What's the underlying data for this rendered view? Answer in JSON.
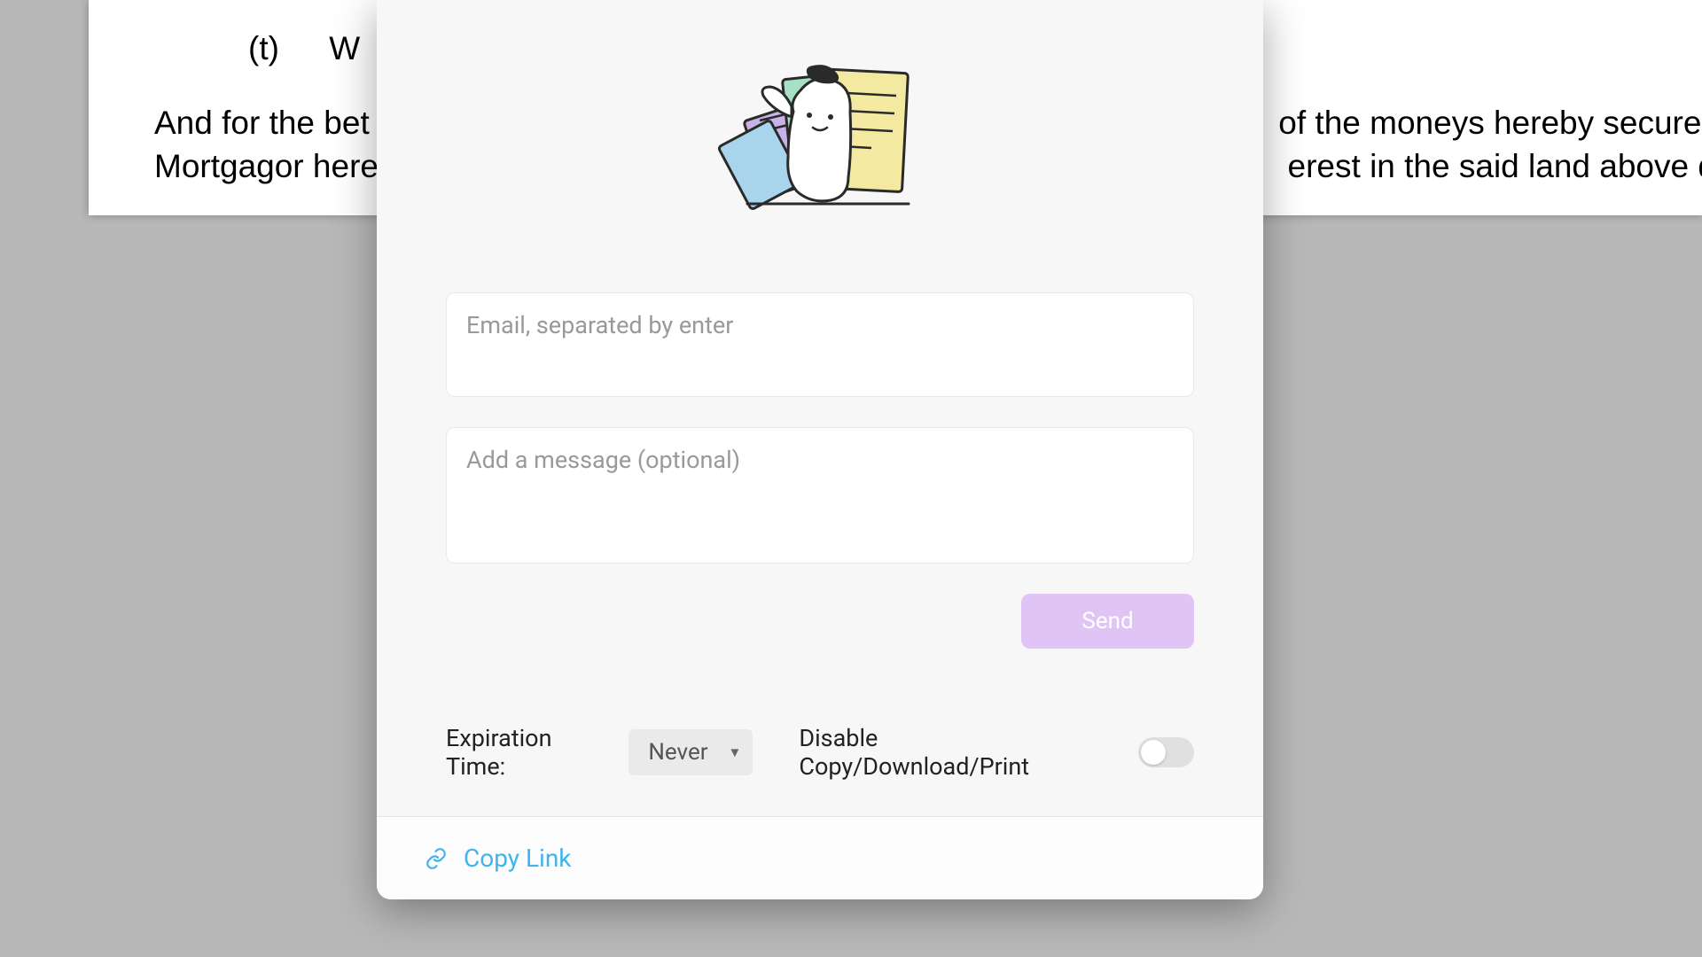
{
  "document": {
    "clause_letter": "(t)",
    "clause_start": "W",
    "paragraph_line1": "And for the bet",
    "paragraph_line1_right": "of the moneys hereby secured, t",
    "paragraph_line2": "Mortgagor here",
    "paragraph_line2_right": "erest in the said land above desc"
  },
  "modal": {
    "email_placeholder": "Email, separated by enter",
    "message_placeholder": "Add a message (optional)",
    "send_label": "Send",
    "expiration_label": "Expiration Time:",
    "expiration_value": "Never",
    "disable_label": "Disable Copy/Download/Print",
    "copy_link_label": "Copy Link"
  }
}
